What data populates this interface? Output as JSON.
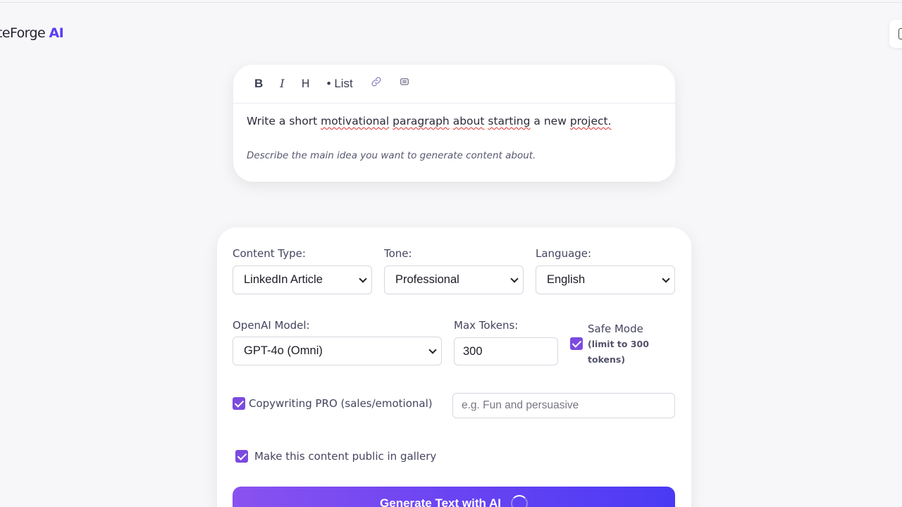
{
  "app": {
    "logo_text": "teForge",
    "logo_accent": "AI"
  },
  "editor": {
    "toolbar": {
      "bold": "B",
      "italic": "I",
      "heading": "H",
      "list": "• List",
      "link_icon": "link-icon",
      "image_icon": "image-icon"
    },
    "content_words": [
      "Write",
      "a",
      "short",
      "motivational",
      "paragraph",
      "about",
      "starting",
      "a",
      "new",
      "project."
    ],
    "hint": "Describe the main idea you want to generate content about."
  },
  "form": {
    "content_type": {
      "label": "Content Type:",
      "value": "LinkedIn Article"
    },
    "tone": {
      "label": "Tone:",
      "value": "Professional"
    },
    "language": {
      "label": "Language:",
      "value": "English"
    },
    "model": {
      "label": "OpenAI Model:",
      "value": "GPT-4o (Omni)"
    },
    "max_tokens": {
      "label": "Max Tokens:",
      "value": "300"
    },
    "safe_mode": {
      "label": "Safe Mode",
      "note_line1": "(limit to 300",
      "note_line2": "tokens)",
      "checked": true
    },
    "copywriting": {
      "label": "Copywriting PRO (sales/emotional)",
      "checked": true,
      "placeholder": "e.g. Fun and persuasive"
    },
    "public": {
      "label": "Make this content public in gallery",
      "checked": true
    },
    "generate_label": "Generate Text with AI"
  },
  "colors": {
    "accent": "#5b3df5",
    "checkbox": "#7b4be0"
  }
}
